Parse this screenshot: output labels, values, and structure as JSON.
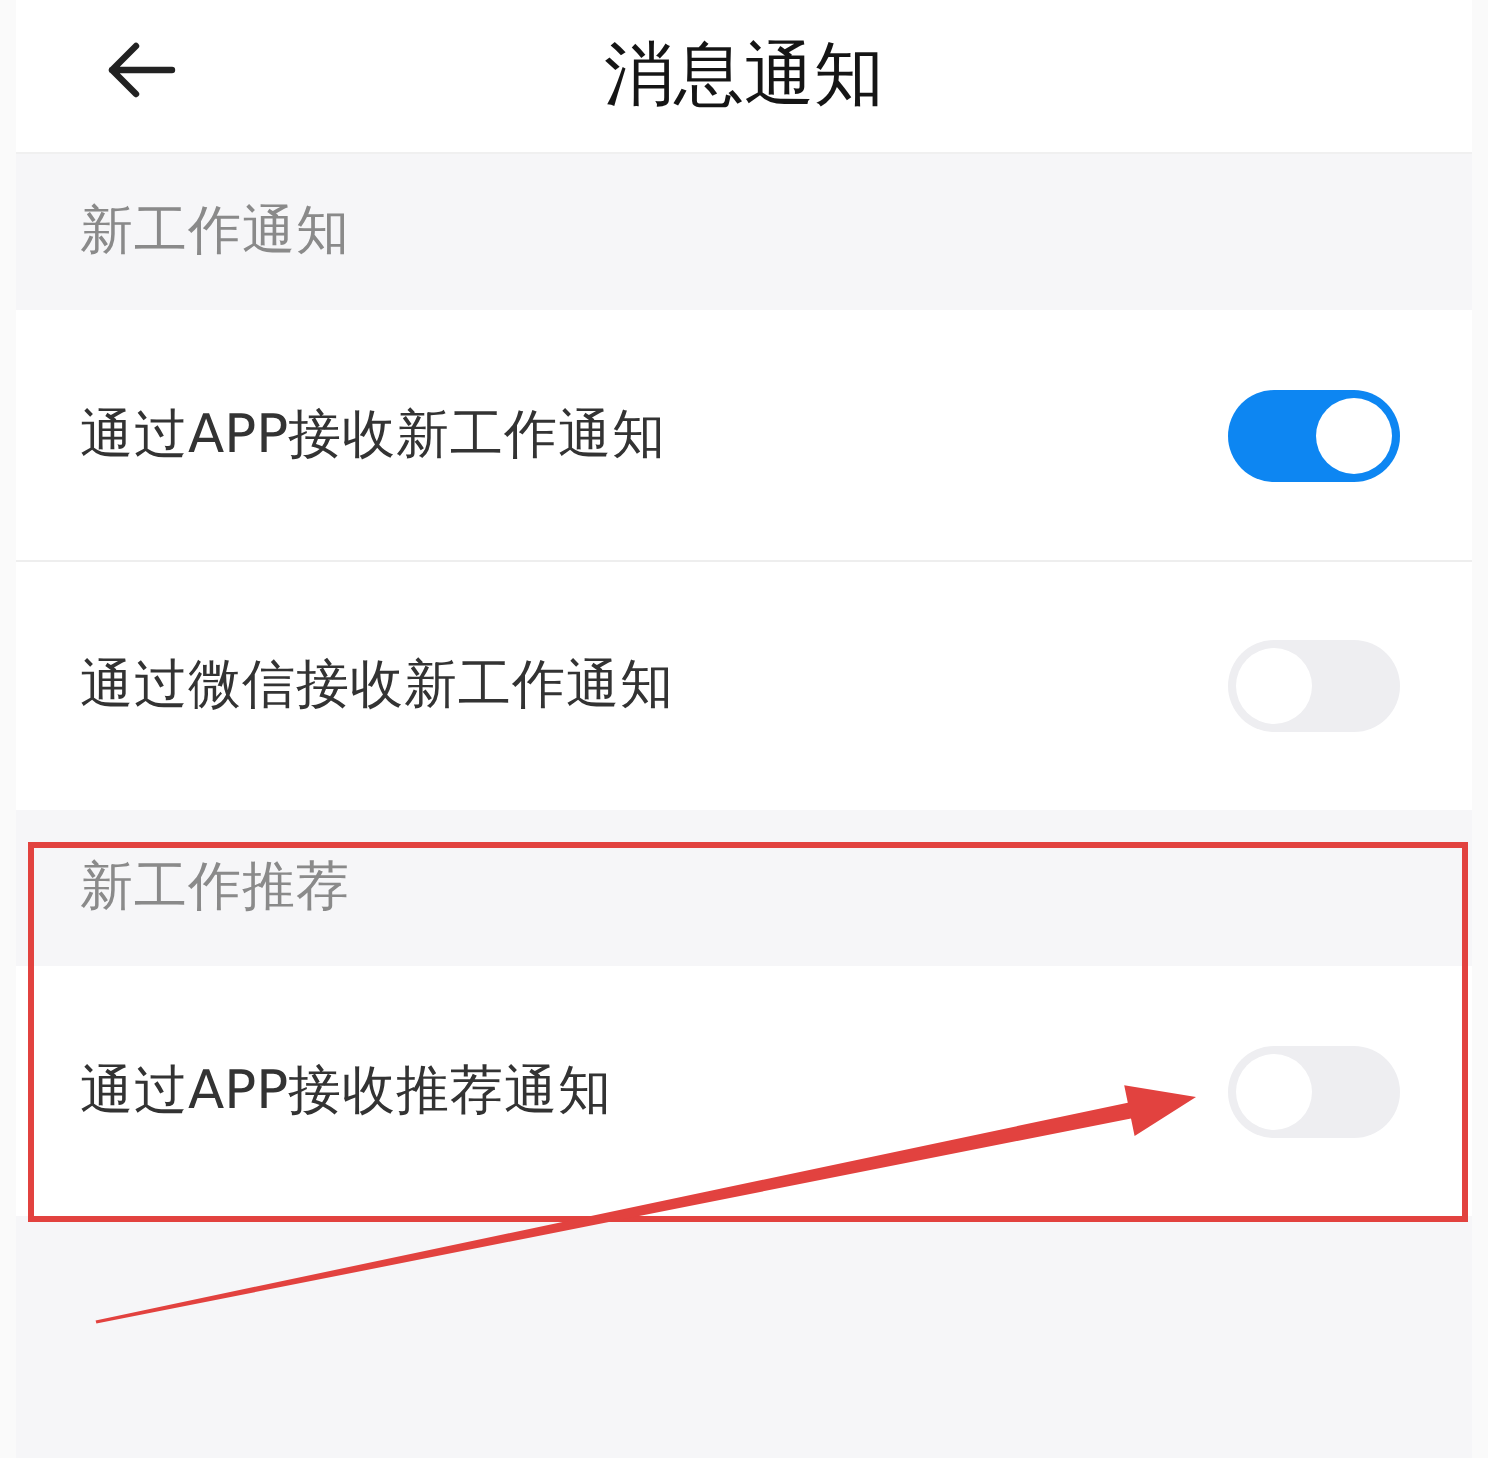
{
  "header": {
    "title": "消息通知"
  },
  "sections": [
    {
      "title": "新工作通知",
      "highlighted": false,
      "items": [
        {
          "label": "通过APP接收新工作通知",
          "on": true
        },
        {
          "label": "通过微信接收新工作通知",
          "on": false
        }
      ]
    },
    {
      "title": "新工作推荐",
      "highlighted": true,
      "items": [
        {
          "label": "通过APP接收推荐通知",
          "on": false
        }
      ]
    }
  ]
}
